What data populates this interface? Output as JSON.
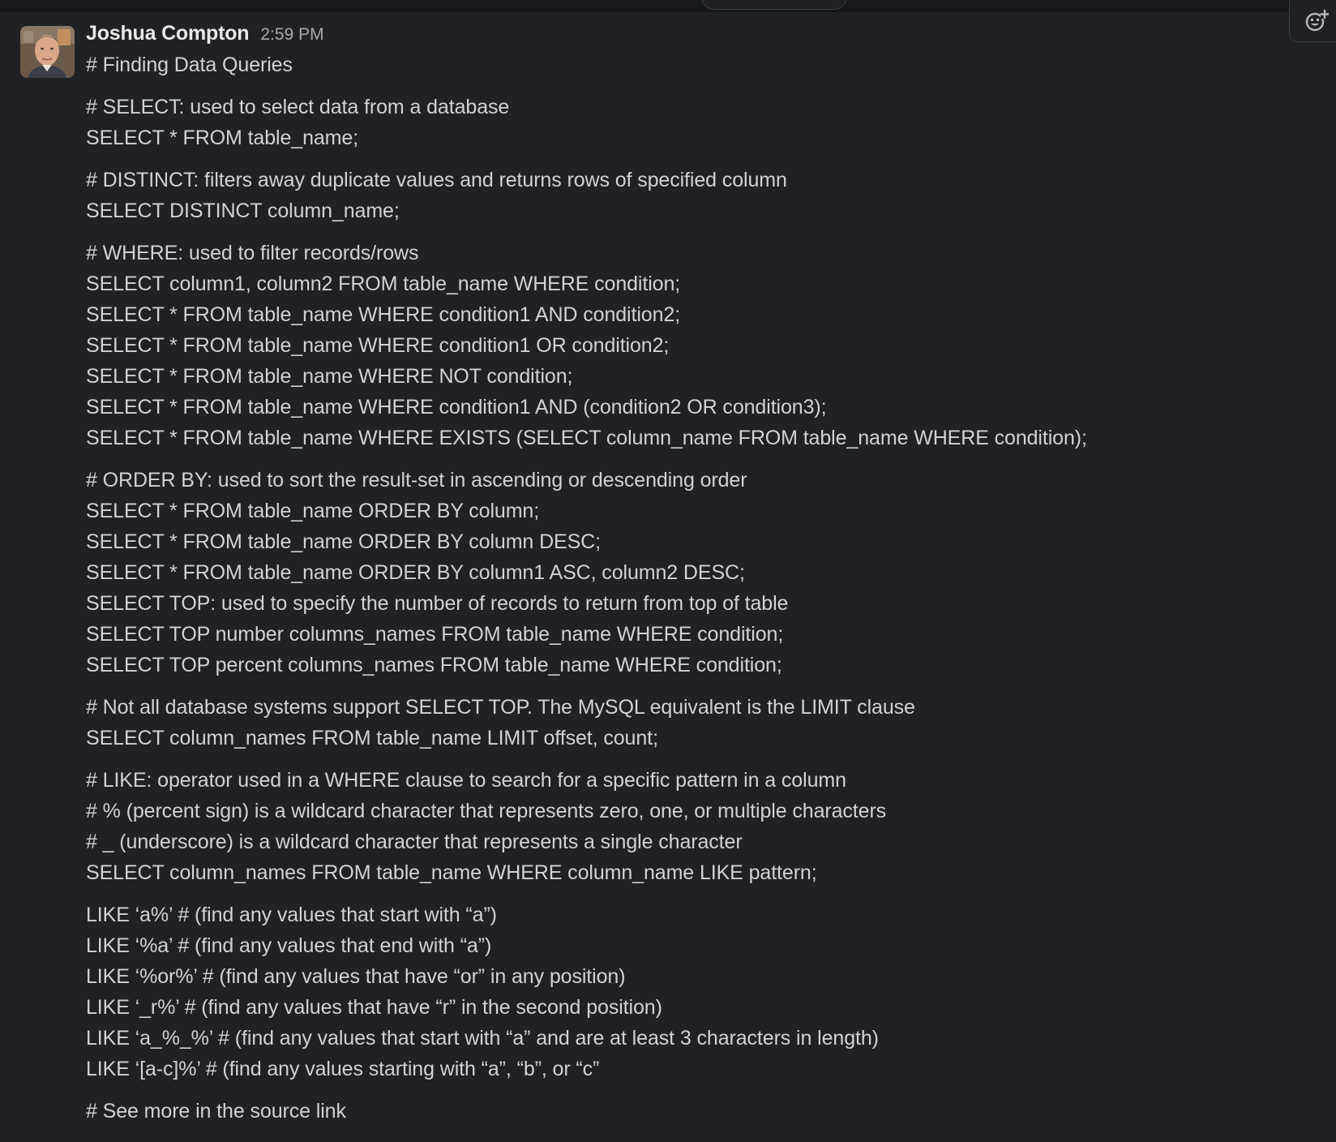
{
  "message": {
    "author": "Joshua Compton",
    "timestamp": "2:59 PM",
    "paragraphs": [
      [
        "# Finding Data Queries"
      ],
      [
        "# SELECT: used to select data from a database",
        "SELECT * FROM table_name;"
      ],
      [
        "# DISTINCT: filters away duplicate values and returns rows of specified column",
        "SELECT DISTINCT column_name;"
      ],
      [
        "# WHERE: used to filter records/rows",
        "SELECT column1, column2 FROM table_name WHERE condition;",
        "SELECT * FROM table_name WHERE condition1 AND condition2;",
        "SELECT * FROM table_name WHERE condition1 OR condition2;",
        "SELECT * FROM table_name WHERE NOT condition;",
        "SELECT * FROM table_name WHERE condition1 AND (condition2 OR condition3);",
        "SELECT * FROM table_name WHERE EXISTS (SELECT column_name FROM table_name WHERE condition);"
      ],
      [
        "# ORDER BY: used to sort the result-set in ascending or descending order",
        "SELECT * FROM table_name ORDER BY column;",
        "SELECT * FROM table_name ORDER BY column DESC;",
        "SELECT * FROM table_name ORDER BY column1 ASC, column2 DESC;",
        "SELECT TOP: used to specify the number of records to return from top of table",
        "SELECT TOP number columns_names FROM table_name WHERE condition;",
        "SELECT TOP percent columns_names FROM table_name WHERE condition;"
      ],
      [
        "# Not all database systems support SELECT TOP. The MySQL equivalent is the LIMIT clause",
        "SELECT column_names FROM table_name LIMIT offset, count;"
      ],
      [
        "# LIKE: operator used in a WHERE clause to search for a specific pattern in a column",
        "# % (percent sign) is a wildcard character that represents zero, one, or multiple characters",
        "# _ (underscore) is a wildcard character that represents a single character",
        "SELECT column_names FROM table_name WHERE column_name LIKE pattern;"
      ],
      [
        "LIKE ‘a%’ # (find any values that start with “a”)",
        "LIKE ‘%a’ # (find any values that end with “a”)",
        "LIKE ‘%or%’ # (find any values that have “or” in any position)",
        "LIKE ‘_r%’ # (find any values that have “r” in the second position)",
        "LIKE ‘a_%_%’ # (find any values that start with “a” and are at least 3 characters in length)",
        "LIKE ‘[a-c]%’ # (find any values starting with “a”, “b”, or “c”"
      ],
      [
        "# See more in the source link"
      ]
    ]
  },
  "toolbar": {
    "icon": "add-reaction-icon"
  },
  "colors": {
    "background": "#1f2125",
    "text": "#d1d2d3",
    "author": "#e8e8e8",
    "timestamp": "#a8a9ab"
  }
}
